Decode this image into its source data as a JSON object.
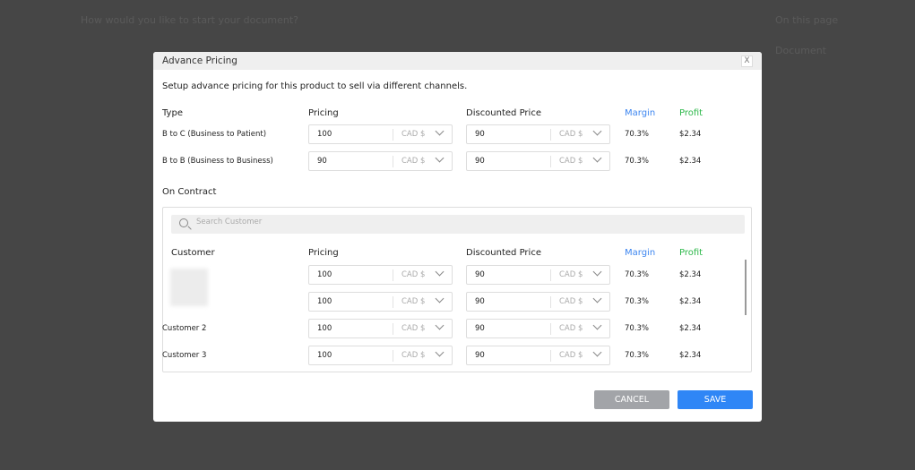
{
  "background": {
    "prompt": "How would you like to start your document?",
    "on_this_page": "On this page",
    "document": "Document"
  },
  "modal": {
    "title": "Advance Pricing",
    "close_label": "X",
    "subtitle": "Setup advance pricing for this product to sell via different channels.",
    "headers": {
      "type": "Type",
      "pricing": "Pricing",
      "discounted": "Discounted Price",
      "margin": "Margin",
      "profit": "Profit",
      "customer": "Customer"
    },
    "rows": [
      {
        "label": "B to C (Business to Patient)",
        "pricing": "100",
        "currency": "CAD $",
        "discounted": "90",
        "disc_currency": "CAD $",
        "margin": "70.3%",
        "profit": "$2.34"
      },
      {
        "label": "B to B (Business to Business)",
        "pricing": "90",
        "currency": "CAD $",
        "discounted": "90",
        "disc_currency": "CAD $",
        "margin": "70.3%",
        "profit": "$2.34"
      }
    ],
    "contract_title": "On Contract",
    "search_placeholder": "Search Customer",
    "contract_rows": [
      {
        "label": "",
        "pricing": "100",
        "currency": "CAD $",
        "discounted": "90",
        "disc_currency": "CAD $",
        "margin": "70.3%",
        "profit": "$2.34"
      },
      {
        "label": "",
        "pricing": "100",
        "currency": "CAD $",
        "discounted": "90",
        "disc_currency": "CAD $",
        "margin": "70.3%",
        "profit": "$2.34"
      },
      {
        "label": "Customer 2",
        "pricing": "100",
        "currency": "CAD $",
        "discounted": "90",
        "disc_currency": "CAD $",
        "margin": "70.3%",
        "profit": "$2.34"
      },
      {
        "label": "Customer 3",
        "pricing": "100",
        "currency": "CAD $",
        "discounted": "90",
        "disc_currency": "CAD $",
        "margin": "70.3%",
        "profit": "$2.34"
      }
    ],
    "cancel_label": "CANCEL",
    "save_label": "SAVE"
  },
  "colors": {
    "margin": "#3d86f0",
    "profit": "#2db84a",
    "save": "#2f86f6",
    "cancel": "#a2a4a8"
  }
}
